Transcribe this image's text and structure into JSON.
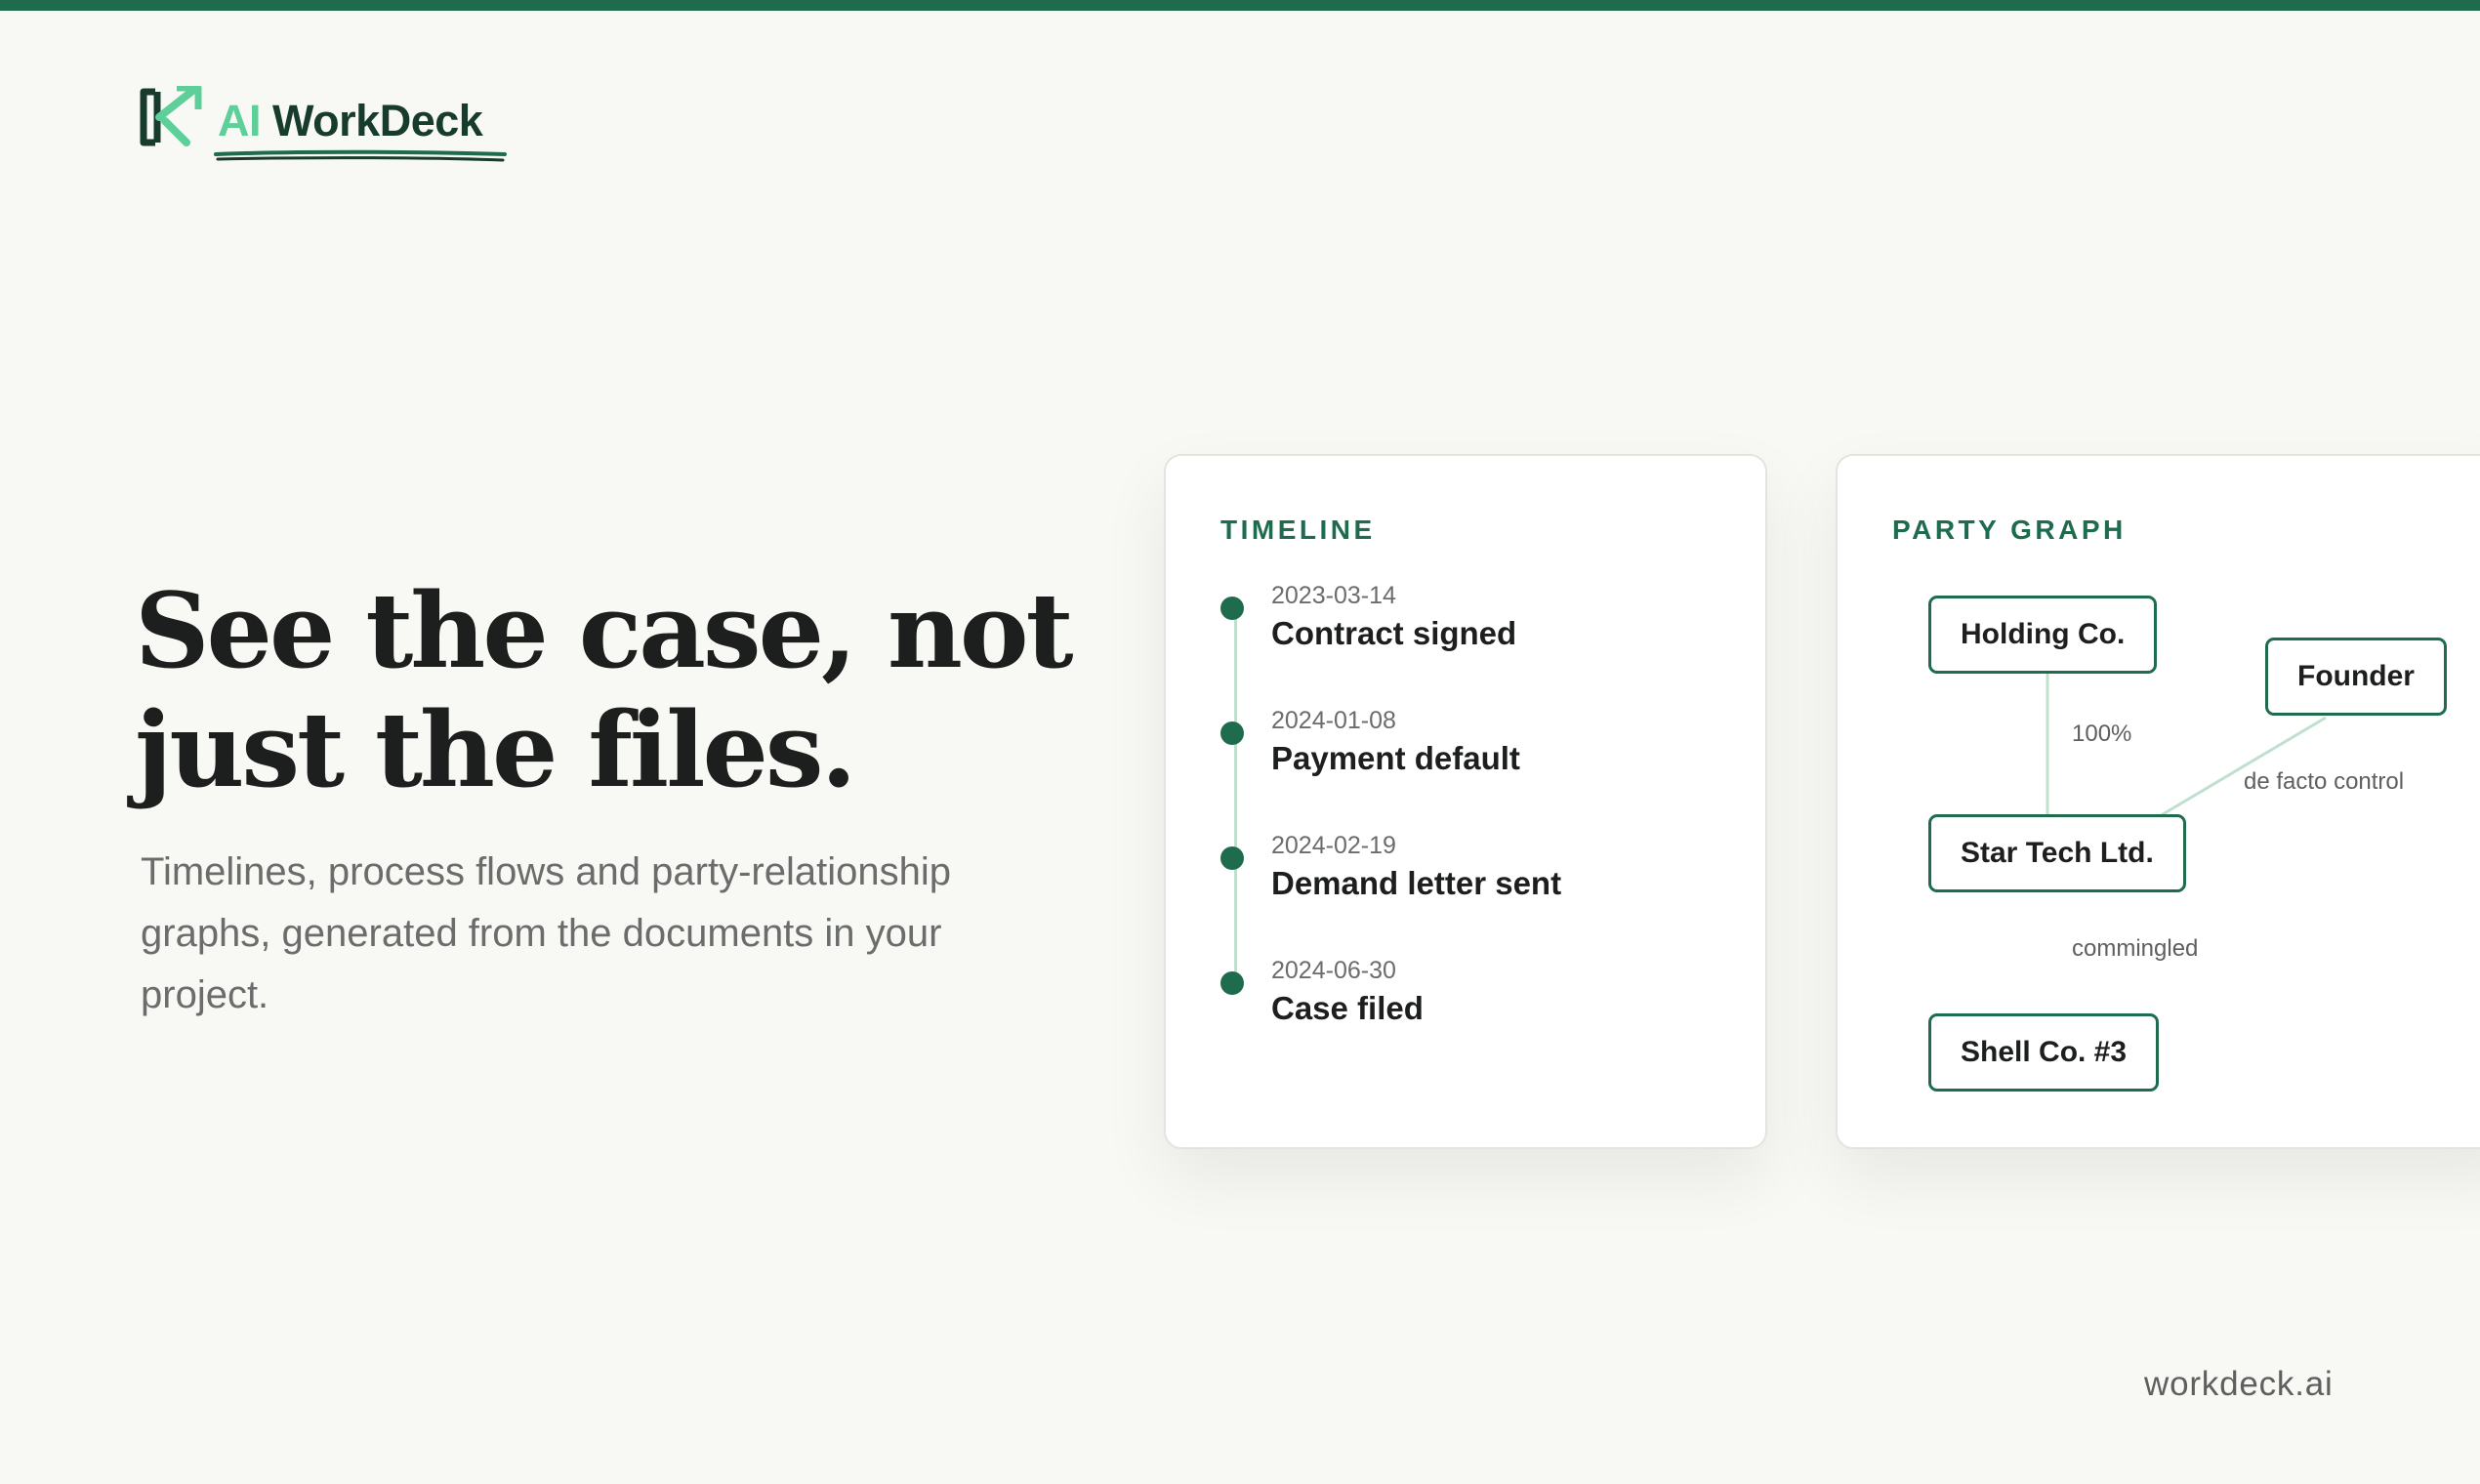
{
  "brand": {
    "logo_ai": "AI",
    "logo_word": "WorkDeck",
    "accent_color": "#1f6b4e",
    "logo_light_color": "#5fcf9a",
    "icon": "workdeck-k-arrow-icon"
  },
  "hero": {
    "headline_line1": "See the case, not",
    "headline_line2": "just the files.",
    "subhead": "Timelines, process flows and party-relationship graphs, generated from the documents in your project."
  },
  "timeline": {
    "label": "TIMELINE",
    "events": [
      {
        "date": "2023-03-14",
        "title": "Contract signed"
      },
      {
        "date": "2024-01-08",
        "title": "Payment default"
      },
      {
        "date": "2024-02-19",
        "title": "Demand letter sent"
      },
      {
        "date": "2024-06-30",
        "title": "Case filed"
      }
    ]
  },
  "party_graph": {
    "label": "PARTY GRAPH",
    "nodes": [
      "Holding Co.",
      "Founder",
      "Star Tech Ltd.",
      "Shell Co. #3"
    ],
    "edges": [
      {
        "from": "Holding Co.",
        "to": "Star Tech Ltd.",
        "label": "100%"
      },
      {
        "from": "Founder",
        "to": "Star Tech Ltd.",
        "label": "de facto control"
      },
      {
        "from": "Star Tech Ltd.",
        "to": "Shell Co. #3",
        "label": "commingled"
      }
    ]
  },
  "footer": {
    "url": "workdeck.ai"
  }
}
